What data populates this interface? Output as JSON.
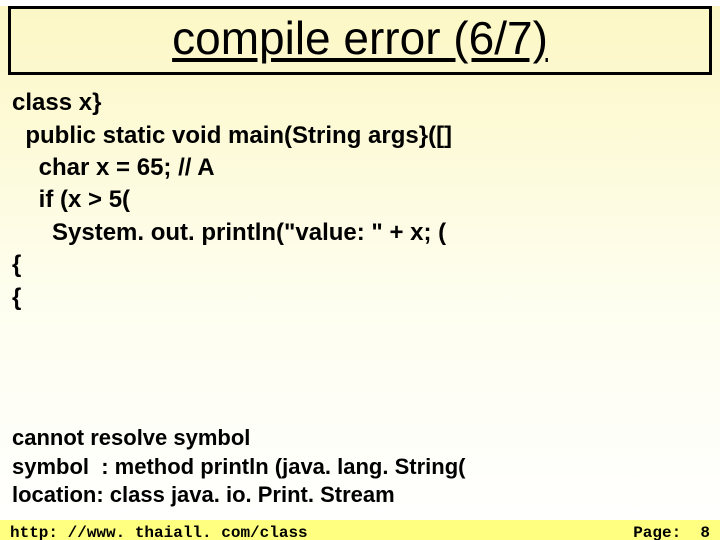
{
  "title": "compile error (6/7)",
  "code": "class x}\n  public static void main(String args}([]\n    char x = 65; // A\n    if (x > 5(\n      System. out. println(\"value: \" + x; (\n{\n{",
  "error": "cannot resolve symbol\nsymbol  : method println (java. lang. String(\nlocation: class java. io. Print. Stream",
  "footer": {
    "url": "http: //www. thaiall. com/class",
    "page_label": "Page:  8"
  }
}
